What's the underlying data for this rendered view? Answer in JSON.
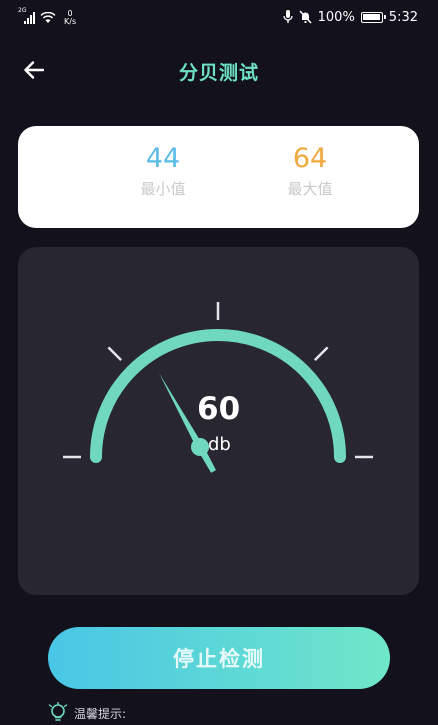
{
  "status_bar": {
    "signal_tag": "2G",
    "speed_value": "0",
    "speed_unit": "K/s",
    "battery_percent": "100%",
    "time": "5:32",
    "icons": [
      "signal-icon",
      "wifi-icon",
      "microphone-icon",
      "mute-icon",
      "battery-icon"
    ]
  },
  "header": {
    "title": "分贝测试",
    "back_icon": "arrow-left-icon"
  },
  "stats": {
    "min_value": "44",
    "min_label": "最小值",
    "max_value": "64",
    "max_label": "最大值"
  },
  "gauge": {
    "value": "60",
    "unit": "db",
    "level": 60,
    "scale_min": 0,
    "scale_max": 120,
    "arc_color": "#6fd8bd",
    "tick_color": "#e6e6ea"
  },
  "stop_button": {
    "label": "停止检测"
  },
  "tip": {
    "label": "温馨提示:",
    "icon": "lightbulb-icon"
  }
}
